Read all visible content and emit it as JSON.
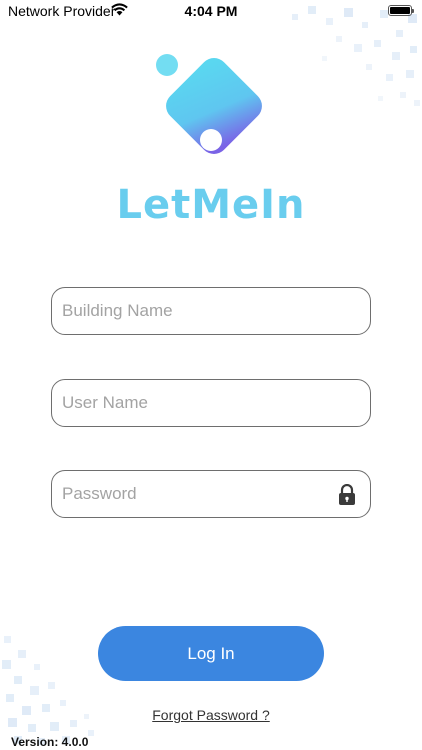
{
  "status_bar": {
    "carrier": "Network Provider",
    "time": "4:04 PM",
    "wifi_icon": "wifi-icon",
    "battery_icon": "battery-icon"
  },
  "brand": {
    "name": "LetMeIn",
    "text_color": "#69cdee",
    "gradient_start": "#5ad7f0",
    "gradient_end": "#7a63e6"
  },
  "form": {
    "building_placeholder": "Building Name",
    "username_placeholder": "User Name",
    "password_placeholder": "Password",
    "password_icon": "lock-icon"
  },
  "actions": {
    "login_label": "Log In",
    "login_color": "#3b86e0",
    "forgot_label": "Forgot Password ?"
  },
  "footer": {
    "version": "Version: 4.0.0"
  }
}
